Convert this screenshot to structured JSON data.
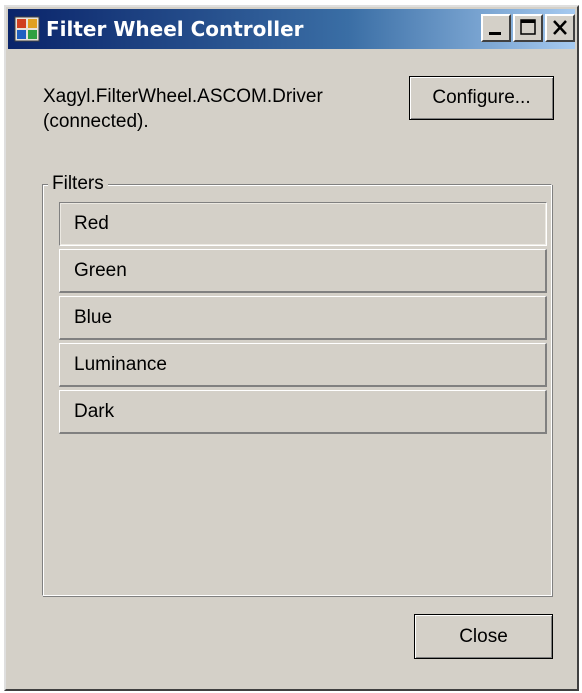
{
  "window": {
    "title": "Filter Wheel Controller",
    "icon": "app-window-icon"
  },
  "titlebar_buttons": {
    "minimize": "minimize-icon",
    "maximize": "maximize-icon",
    "close": "close-icon"
  },
  "driver": {
    "line1": "Xagyl.FilterWheel.ASCOM.Driver",
    "line2": "(connected)."
  },
  "buttons": {
    "configure_label": "Configure...",
    "close_label": "Close"
  },
  "filters": {
    "group_label": "Filters",
    "items": [
      {
        "label": "Red",
        "selected": true
      },
      {
        "label": "Green",
        "selected": false
      },
      {
        "label": "Blue",
        "selected": false
      },
      {
        "label": "Luminance",
        "selected": false
      },
      {
        "label": "Dark",
        "selected": false
      }
    ]
  },
  "colors": {
    "window_bg": "#d4d0c8",
    "titlebar_start": "#0a246a",
    "titlebar_end": "#a6caf0"
  }
}
